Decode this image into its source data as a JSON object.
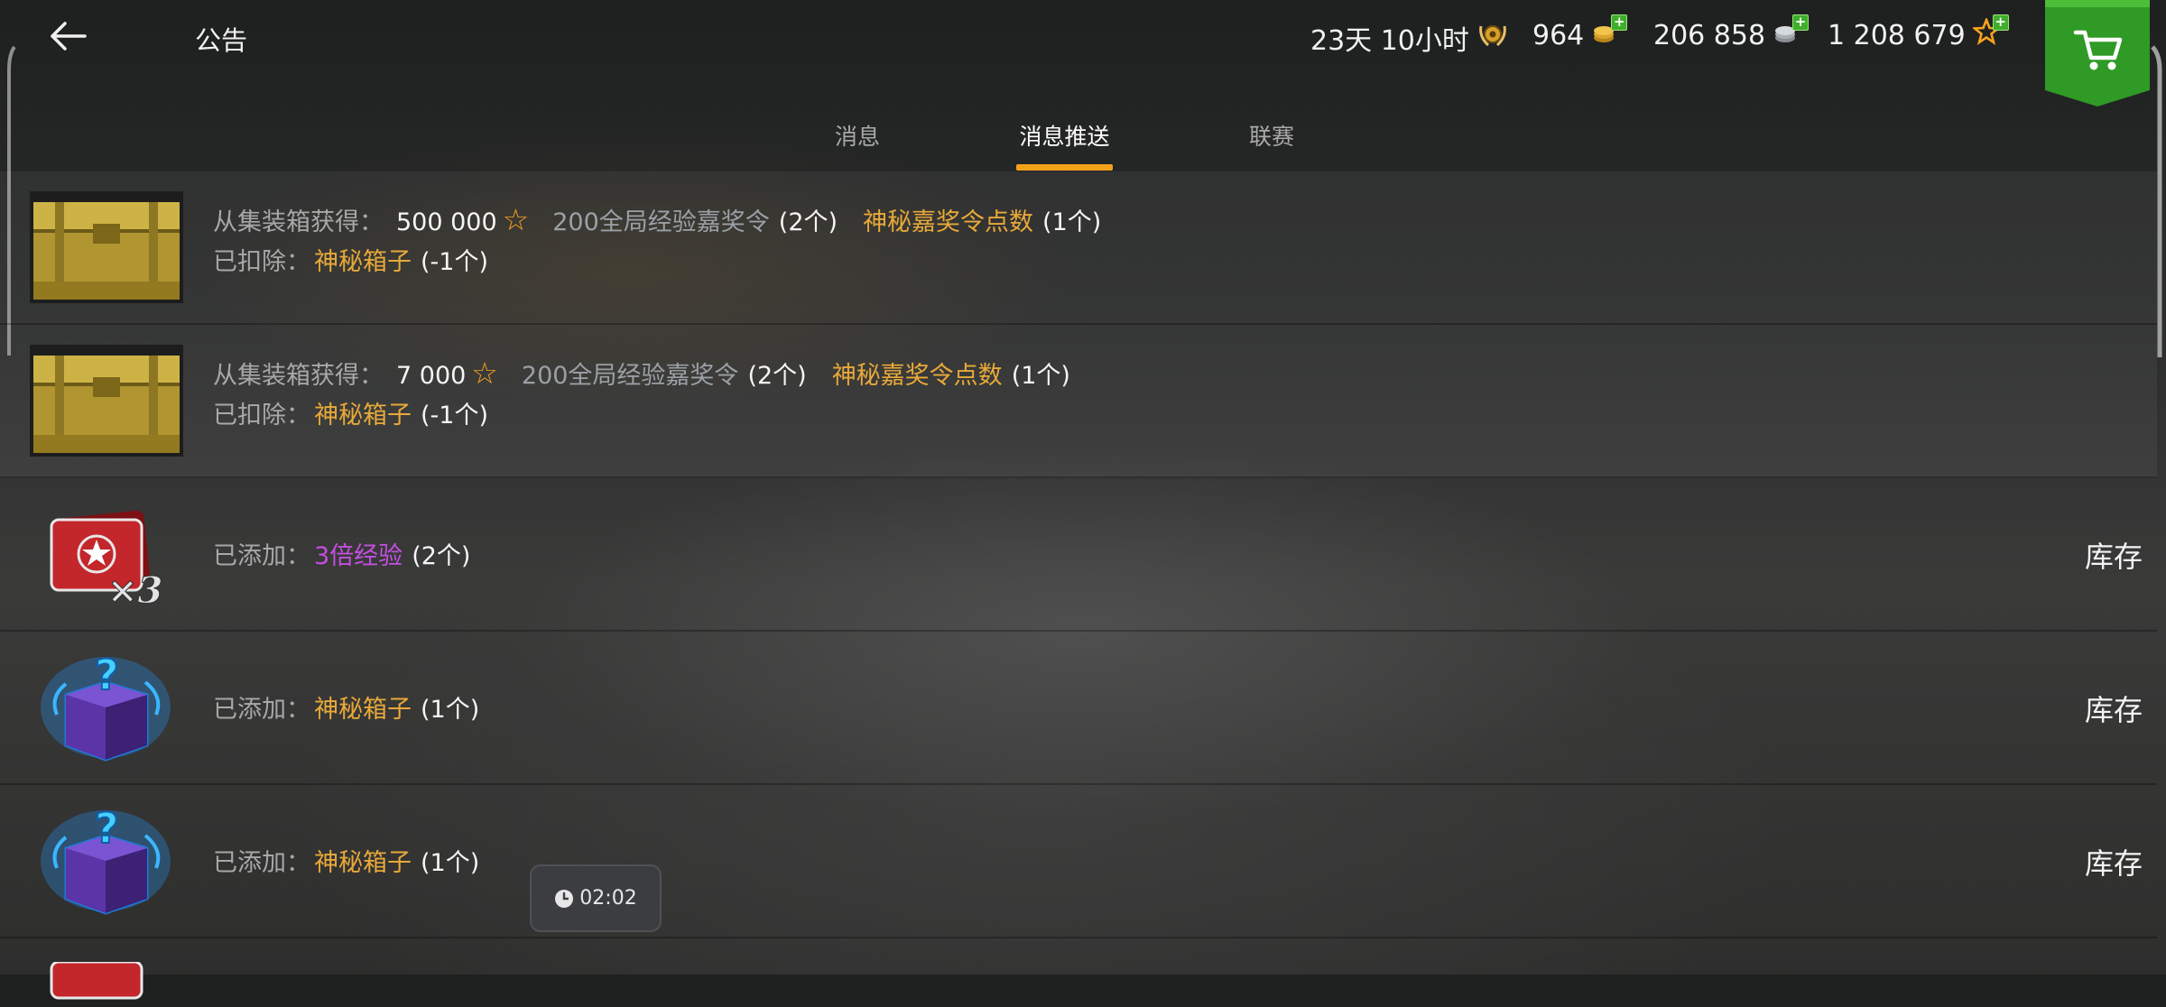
{
  "header": {
    "title": "公告",
    "timer_text": "23天 10小时",
    "gold": "964",
    "silver": "206 858",
    "free_xp": "1 208 679"
  },
  "tabs": [
    {
      "label": "消息",
      "active": false
    },
    {
      "label": "消息推送",
      "active": true
    },
    {
      "label": "联赛",
      "active": false
    }
  ],
  "messages": [
    {
      "icon": "gold-chest-icon",
      "line1": {
        "label": "从集装箱获得：",
        "amount": "500 000",
        "item1": "200全局经验嘉奖令",
        "item1_count": "(2个)",
        "item2": "神秘嘉奖令点数",
        "item2_count": "(1个)"
      },
      "line2": {
        "label": "已扣除：",
        "item": "神秘箱子",
        "count": "(-1个)"
      }
    },
    {
      "icon": "gold-chest-icon",
      "line1": {
        "label": "从集装箱获得：",
        "amount": "7 000",
        "item1": "200全局经验嘉奖令",
        "item1_count": "(2个)",
        "item2": "神秘嘉奖令点数",
        "item2_count": "(1个)"
      },
      "line2": {
        "label": "已扣除：",
        "item": "神秘箱子",
        "count": "(-1个)"
      }
    },
    {
      "icon": "triple-xp-card-icon",
      "label": "已添加：",
      "item": "3倍经验",
      "item_color": "#c44fe0",
      "count": "(2个)",
      "action": "库存"
    },
    {
      "icon": "mystery-box-icon",
      "label": "已添加：",
      "item": "神秘箱子",
      "item_color": "#e8a93a",
      "count": "(1个)",
      "action": "库存"
    },
    {
      "icon": "mystery-box-icon",
      "label": "已添加：",
      "item": "神秘箱子",
      "item_color": "#e8a93a",
      "count": "(1个)",
      "action": "库存"
    }
  ],
  "overlay": {
    "clock_text": "02:02"
  },
  "colors": {
    "accent": "#f3a21a",
    "gold_item": "#e8a93a",
    "purple_item": "#c44fe0",
    "shop_green": "#2f9a25"
  }
}
